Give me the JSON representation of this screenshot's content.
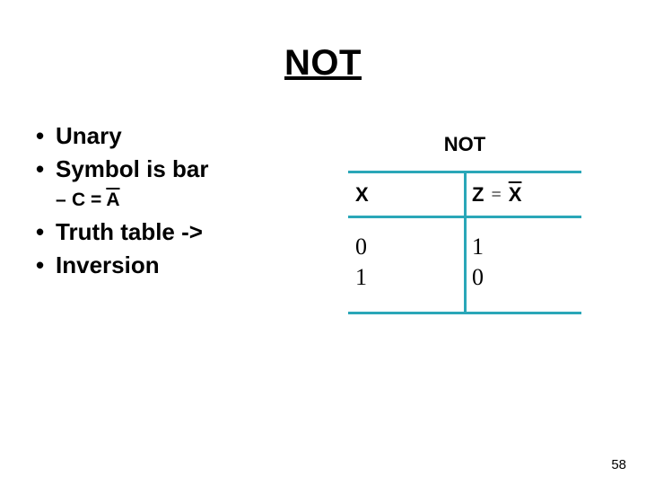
{
  "title": "NOT",
  "bullets": {
    "items": [
      {
        "level": 1,
        "text": "Unary"
      },
      {
        "level": 1,
        "text": "Symbol is bar"
      },
      {
        "level": 2,
        "prefix": "C = ",
        "overbar": "A"
      },
      {
        "level": 1,
        "text": "Truth table ->"
      },
      {
        "level": 1,
        "text": "Inversion"
      }
    ]
  },
  "figure": {
    "heading": "NOT",
    "col_x": "X",
    "col_z_lhs": "Z",
    "col_z_eq": "=",
    "col_z_rhs_overbar": "X"
  },
  "chart_data": {
    "type": "table",
    "title": "NOT truth table",
    "columns": [
      "X",
      "Z = NOT X"
    ],
    "rows": [
      {
        "X": 0,
        "Z": 1
      },
      {
        "X": 1,
        "Z": 0
      }
    ]
  },
  "page_number": "58"
}
